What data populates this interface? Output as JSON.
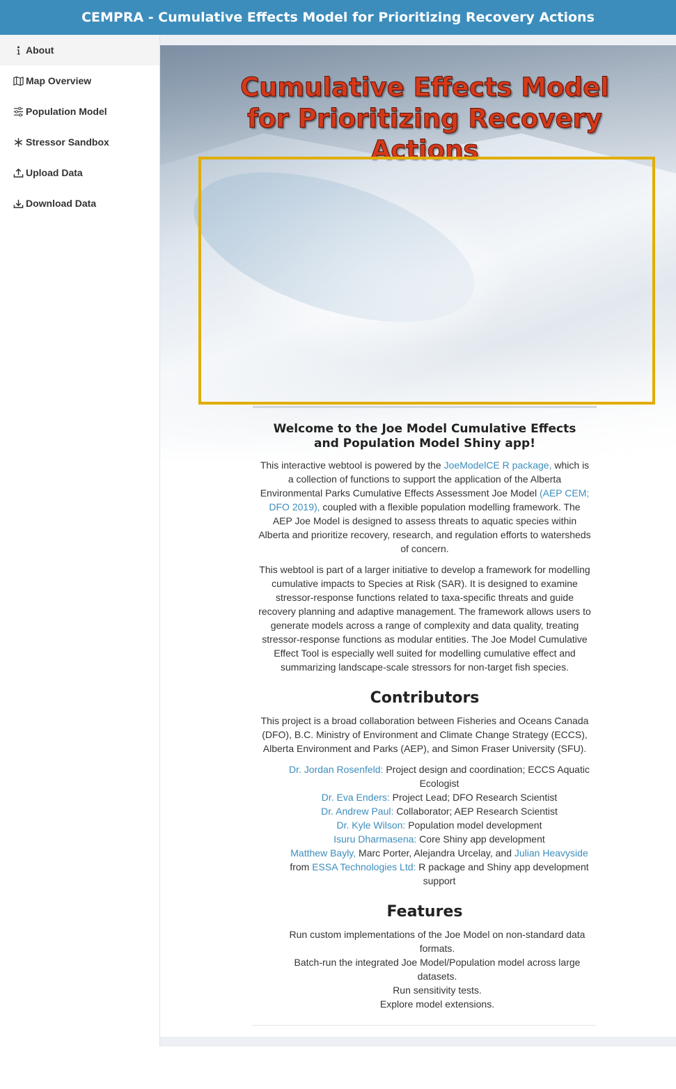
{
  "header": {
    "title": "CEMPRA - Cumulative Effects Model for Prioritizing Recovery Actions"
  },
  "sidebar": {
    "items": [
      {
        "label": "About",
        "icon": "info-icon",
        "active": true
      },
      {
        "label": "Map Overview",
        "icon": "map-icon"
      },
      {
        "label": "Population Model",
        "icon": "sliders-icon"
      },
      {
        "label": "Stressor Sandbox",
        "icon": "asterisk-icon"
      },
      {
        "label": "Upload Data",
        "icon": "upload-icon"
      },
      {
        "label": "Download Data",
        "icon": "download-icon"
      }
    ]
  },
  "hero": {
    "title": "Cumulative Effects Model for Prioritizing Recovery Actions",
    "frame_color": "#e1ad01"
  },
  "about": {
    "welcome": "Welcome to the Joe Model Cumulative Effects and Population Model Shiny app!",
    "p1": {
      "t1": "This interactive webtool is powered by the ",
      "link1": "JoeModelCE R package,",
      "t2": " which is a collection of functions to support the application of the Alberta Environmental Parks Cumulative Effects Assessment Joe Model ",
      "link2": "(AEP CEM; DFO 2019),",
      "t3": " coupled with a flexible population modelling framework. The AEP Joe Model is designed to assess threats to aquatic species within Alberta and prioritize recovery, research, and regulation efforts to watersheds of concern."
    },
    "p2": "This webtool is part of a larger initiative to develop a framework for modelling cumulative impacts to Species at Risk (SAR). It is designed to examine stressor-response functions related to taxa-specific threats and guide recovery planning and adaptive management. The framework allows users to generate models across a range of complexity and data quality, treating stressor-response functions as modular entities. The Joe Model Cumulative Effect Tool is especially well suited for modelling cumulative effect and summarizing landscape-scale stressors for non-target fish species."
  },
  "contributors": {
    "heading": "Contributors",
    "intro": "This project is a broad collaboration between Fisheries and Oceans Canada (DFO), B.C. Ministry of Environment and Climate Change Strategy (ECCS), Alberta Environment and Parks (AEP), and Simon Fraser University (SFU).",
    "people": [
      {
        "name": "Dr. Jordan Rosenfeld:",
        "role": " Project design and coordination; ECCS Aquatic Ecologist"
      },
      {
        "name": "Dr. Eva Enders:",
        "role": " Project Lead; DFO Research Scientist"
      },
      {
        "name": "Dr. Andrew Paul:",
        "role": " Collaborator; AEP Research Scientist"
      },
      {
        "name": "Dr. Kyle Wilson:",
        "role": " Population model development"
      },
      {
        "name": "Isuru Dharmasena:",
        "role": " Core Shiny app development"
      }
    ],
    "essa": {
      "name1": "Matthew Bayly,",
      "mid": " Marc Porter, Alejandra Urcelay, and ",
      "name2": "Julian Heavyside",
      "from": " from ",
      "org": "ESSA Technologies Ltd:",
      "role": " R package and Shiny app development support"
    }
  },
  "features": {
    "heading": "Features",
    "items": [
      "Run custom implementations of the Joe Model on non-standard data formats.",
      "Batch-run the integrated Joe Model/Population model across large datasets.",
      "Run sensitivity tests.",
      "Explore model extensions."
    ]
  },
  "colors": {
    "header": "#3c8dbc",
    "link": "#3c8dbc",
    "title": "#d43a1a"
  }
}
